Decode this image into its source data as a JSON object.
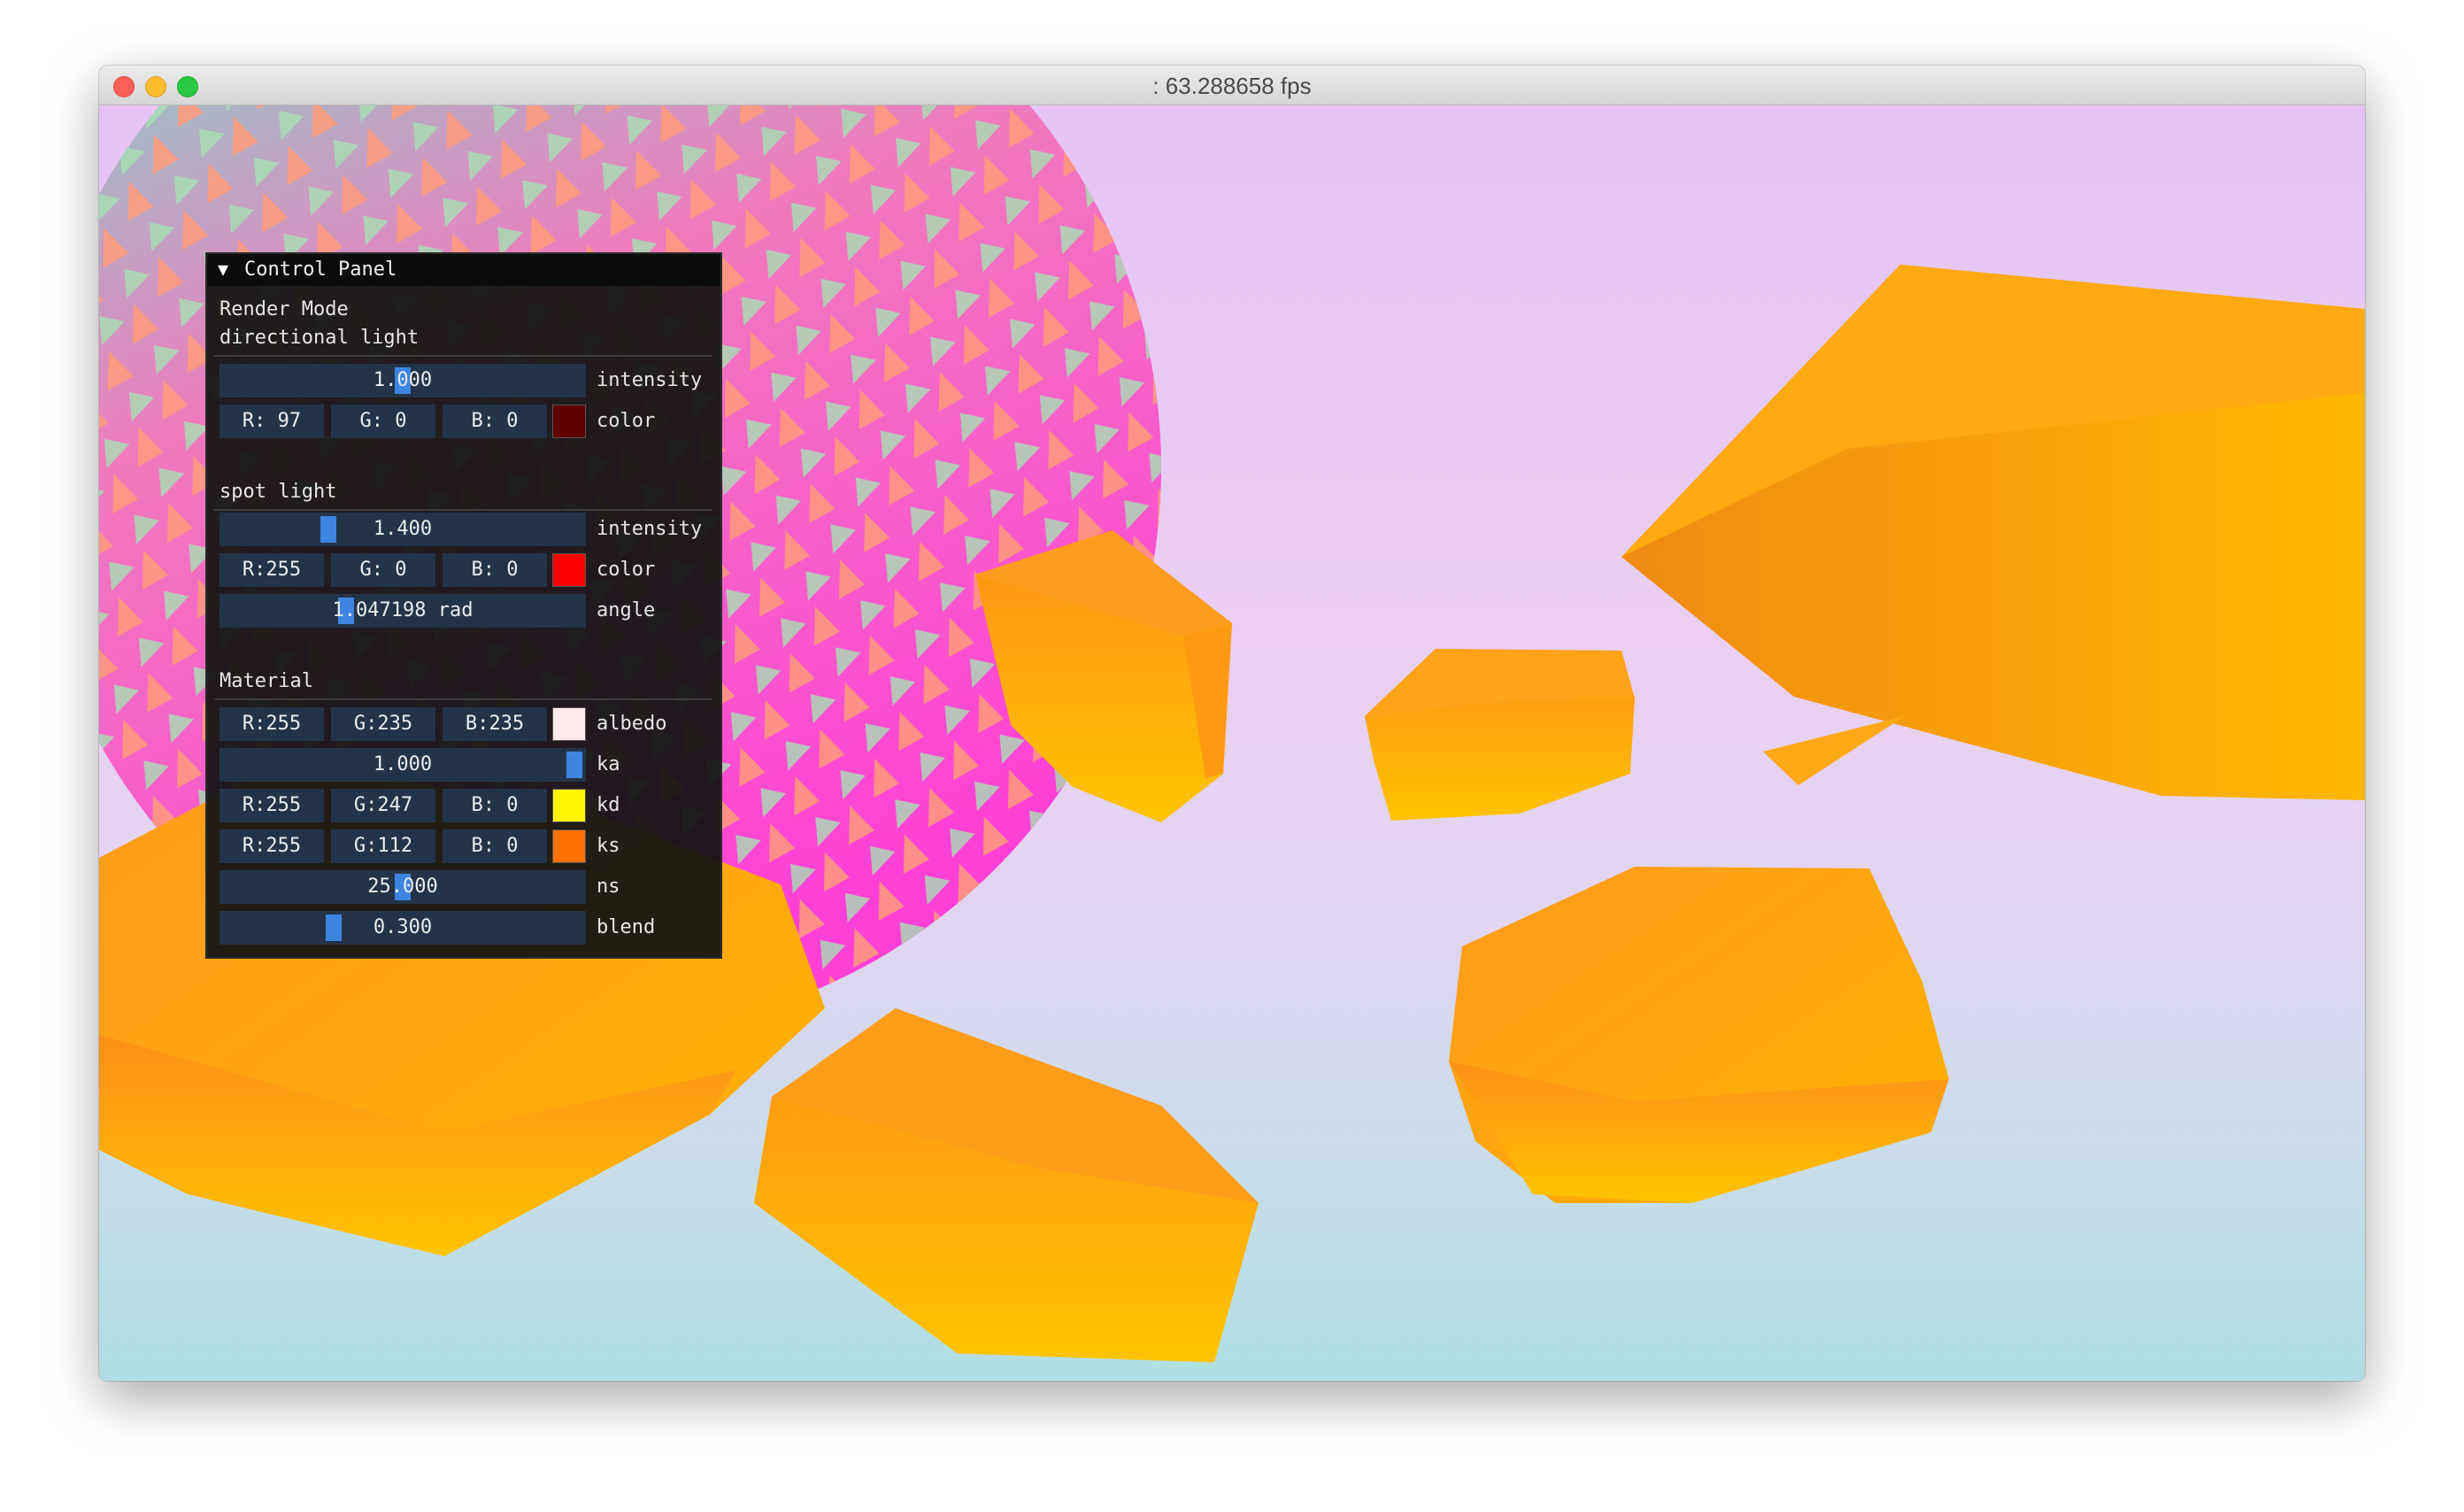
{
  "window": {
    "title": ": 63.288658 fps"
  },
  "panel": {
    "title": "Control Panel",
    "render_mode_label": "Render Mode",
    "directional": {
      "section_label": "directional light",
      "intensity_value": "1.000",
      "intensity_label": "intensity",
      "color_r": "R: 97",
      "color_g": "G:  0",
      "color_b": "B:  0",
      "color_hex": "#610000",
      "color_label": "color"
    },
    "spot": {
      "section_label": "spot light",
      "intensity_value": "1.400",
      "intensity_label": "intensity",
      "color_r": "R:255",
      "color_g": "G:  0",
      "color_b": "B:  0",
      "color_hex": "#ff0000",
      "color_label": "color",
      "angle_value": "1.047198 rad",
      "angle_label": "angle"
    },
    "material": {
      "section_label": "Material",
      "albedo_r": "R:255",
      "albedo_g": "G:235",
      "albedo_b": "B:235",
      "albedo_hex": "#ffebeb",
      "albedo_label": "albedo",
      "ka_value": "1.000",
      "ka_label": "ka",
      "kd_r": "R:255",
      "kd_g": "G:247",
      "kd_b": "B:  0",
      "kd_hex": "#fff700",
      "kd_label": "kd",
      "ks_r": "R:255",
      "ks_g": "G:112",
      "ks_b": "B:  0",
      "ks_hex": "#ff7000",
      "ks_label": "ks",
      "ns_value": "25.000",
      "ns_label": "ns",
      "blend_value": "0.300",
      "blend_label": "blend"
    }
  }
}
